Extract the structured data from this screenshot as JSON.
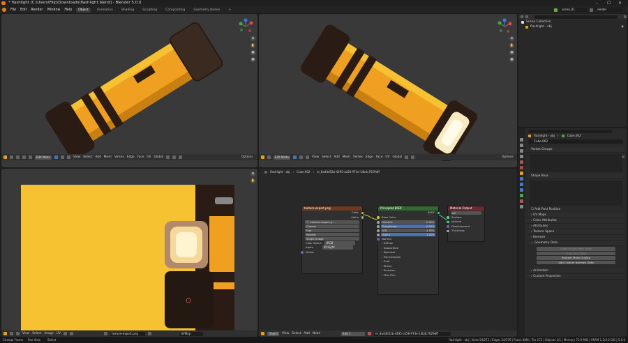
{
  "window": {
    "title": "* flashlight [C:\\Users\\Filip\\Downloads\\flashlight.blend] - Blender 5.0.0"
  },
  "menubar": {
    "menus": [
      "File",
      "Edit",
      "Render",
      "Window",
      "Help"
    ],
    "workspaces": [
      "Object",
      "Animation",
      "Shading",
      "Sculpting",
      "Compositing",
      "Geometry Nodes",
      "+"
    ],
    "active_workspace": "Object",
    "scene": "scene_01",
    "view_layer": "render"
  },
  "viewport_left": {
    "mode": "Edit Mode",
    "menus": [
      "View",
      "Select",
      "Add",
      "Mesh",
      "Vertex",
      "Edge",
      "Face",
      "UV"
    ],
    "orientation": "Global",
    "options_label": "Options"
  },
  "viewport_right": {
    "mode": "Edit Mode",
    "menus": [
      "View",
      "Select",
      "Add",
      "Mesh",
      "Vertex",
      "Edge",
      "Face",
      "UV"
    ],
    "orientation": "Global",
    "options_label": "Options"
  },
  "uv_editor": {
    "menus": [
      "View",
      "Select",
      "Image",
      "UV"
    ],
    "image_name": "texture-export.png",
    "uv_map": "UVMap"
  },
  "node_editor": {
    "breadcrumb": [
      "flashlight - obj",
      "Cube.002",
      "m_8a4dd52b-4495-cb58-974e-14b4c7629dff"
    ],
    "header": {
      "object_label": "Object",
      "menus": [
        "View",
        "Select",
        "Add",
        "Node"
      ],
      "slot": "Slot 1",
      "material": "m_8a4dd52b-4495-cb58-974e-14b4c7629dff"
    },
    "image_node": {
      "title": "texture-export.png",
      "out_color": "Color",
      "out_alpha": "Alpha",
      "image": "texture-export.p...",
      "interpolation": "Closest",
      "projection": "Flat",
      "extension": "Repeat",
      "source": "Single Image",
      "color_space_label": "Color Space",
      "color_space": "sRGB",
      "alpha_label": "Alpha",
      "alpha": "Straight",
      "vector_label": "Vector"
    },
    "bsdf_node": {
      "title": "Principled BSDF",
      "out_bsdf": "BSDF",
      "rows": [
        {
          "label": "Base Color",
          "value": ""
        },
        {
          "label": "Metallic",
          "value": "0.000"
        },
        {
          "label": "Roughness",
          "value": "0.500"
        },
        {
          "label": "IOR",
          "value": "1.500"
        },
        {
          "label": "Alpha",
          "value": "1.000"
        }
      ],
      "normal_label": "Normal",
      "sections": [
        "Diffuse",
        "Subsurface",
        "Specular",
        "Transmission",
        "Coat",
        "Sheen",
        "Emission",
        "Thin Film"
      ]
    },
    "output_node": {
      "title": "Material Output",
      "target": "All",
      "inputs": [
        "Surface",
        "Volume",
        "Displacement",
        "Thickness"
      ]
    }
  },
  "outliner": {
    "scene_collection": "Scene Collection",
    "item": "flashlight - obj"
  },
  "properties": {
    "search_placeholder": "",
    "breadcrumb_object": "flashlight - obj",
    "breadcrumb_mesh": "Cube.002",
    "mesh_name": "Cube.002",
    "sections": {
      "vertex_groups": "Vertex Groups",
      "shape_keys": "Shape Keys",
      "add_rest_position": "Add Rest Position",
      "uv_maps": "UV Maps",
      "color_attributes": "Color Attributes",
      "attributes": "Attributes",
      "texture_space": "Texture Space",
      "remesh": "Remesh",
      "geometry_data": "Geometry Data",
      "animation": "Animation",
      "custom_properties": "Custom Properties"
    },
    "geometry_buttons": [
      "Clear Sculpt Mask Data",
      "Clear Skin Data",
      "Reorder Mesh Quality",
      "Add Custom Normals Data"
    ]
  },
  "statusbar": {
    "left": [
      "Change Frame",
      "Pan View",
      "Select"
    ],
    "right": "flashlight - obj | Verts 54/272 | Edges 24/376 | Faces 8/86 | Tris 172 | Objects 1/1 | Memory 73.9 MiB | VRAM 1.2/4.0 GiB | 5.0.0"
  },
  "colors": {
    "accent": "#e87d0d",
    "viewport_bg": "#393939",
    "flashlight_body": "#f0a020",
    "flashlight_dark": "#2a1c14",
    "node_image_header": "#6b3a1f",
    "node_bsdf_header": "#2f6b2f",
    "node_output_header": "#6b2a33",
    "selection": "#4772b3",
    "uv_bg": "#f6c232"
  }
}
